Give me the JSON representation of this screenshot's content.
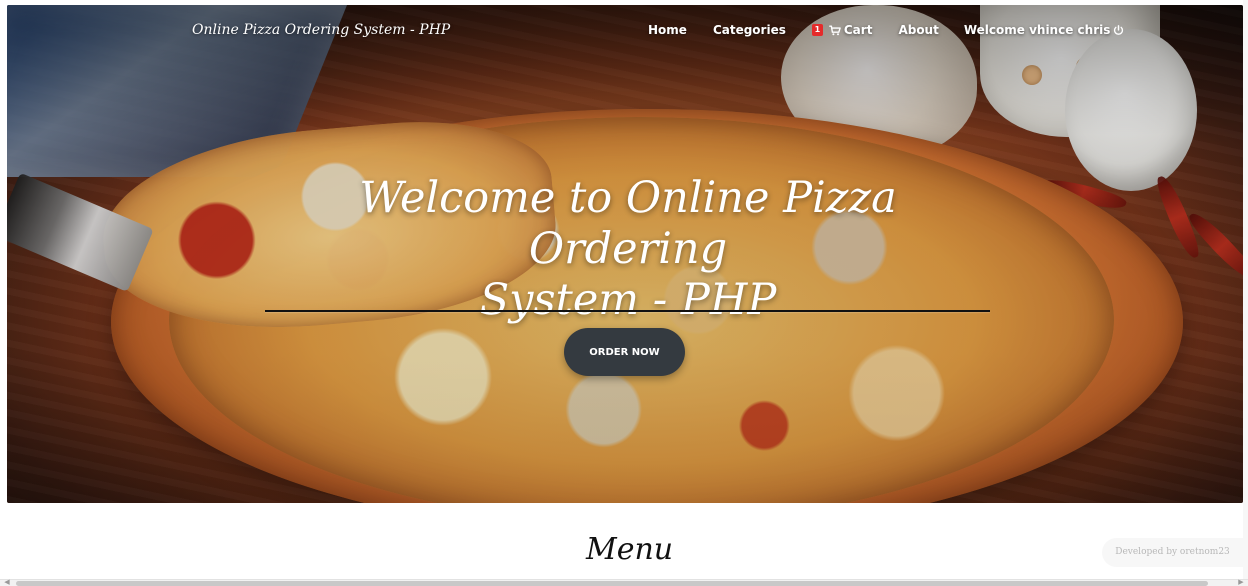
{
  "navbar": {
    "brand": "Online Pizza Ordering System - PHP",
    "links": {
      "home": "Home",
      "categories": "Categories",
      "cart": "Cart",
      "about": "About",
      "welcome": "Welcome vhince chris"
    },
    "cart_count": "1",
    "icons": {
      "cart": "cart-icon",
      "power": "power-icon"
    }
  },
  "hero": {
    "title_line_1": "Welcome to Online Pizza Ordering",
    "title_line_2": "System - PHP",
    "button_label": "ORDER NOW"
  },
  "section": {
    "title": "Menu"
  },
  "footer": {
    "developed_by": "Developed by oretnom23"
  },
  "colors": {
    "hero_button": "#343a40",
    "cart_badge": "#e52b2b",
    "white": "#ffffff"
  }
}
